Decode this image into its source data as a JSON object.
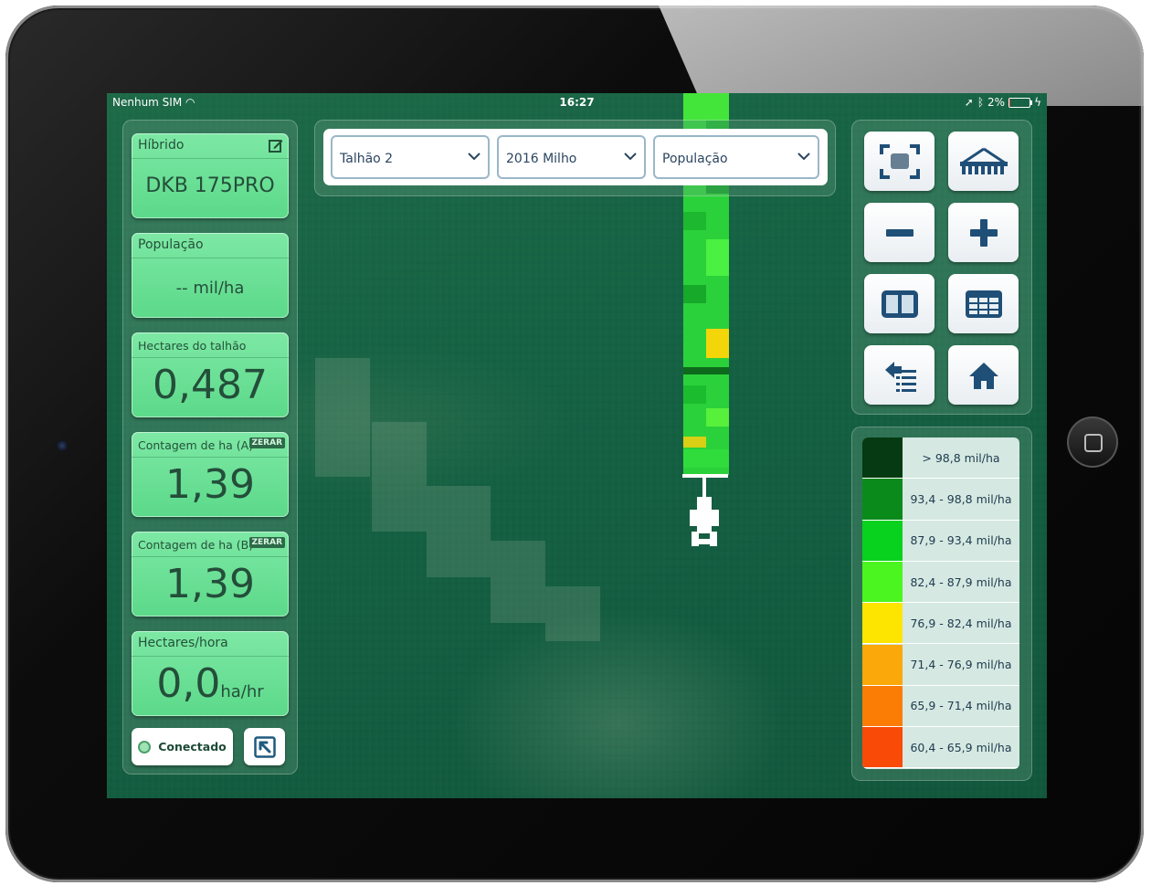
{
  "status_bar": {
    "carrier": "Nenhum SIM",
    "time": "16:27",
    "battery": "2%"
  },
  "cards": {
    "hibrido": {
      "label": "Híbrido",
      "value": "DKB 175PRO"
    },
    "populacao": {
      "label": "População",
      "value": "-- mil/ha"
    },
    "hectares_talhao": {
      "label": "Hectares do talhão",
      "value": "0,487"
    },
    "contagem_a": {
      "label": "Contagem de ha (A)",
      "badge": "ZERAR",
      "value": "1,39"
    },
    "contagem_b": {
      "label": "Contagem de ha (B)",
      "badge": "ZERAR",
      "value": "1,39"
    },
    "hectares_hora": {
      "label": "Hectares/hora",
      "value": "0,0",
      "unit": "ha/hr"
    }
  },
  "connection": {
    "label": "Conectado"
  },
  "dropdowns": {
    "field": "Talhão 2",
    "season": "2016 Milho",
    "layer": "População"
  },
  "toolbar": {
    "icons": [
      "fit-screen-icon",
      "planter-icon",
      "zoom-out-icon",
      "zoom-in-icon",
      "split-view-icon",
      "table-icon",
      "list-back-icon",
      "home-icon"
    ]
  },
  "legend": [
    {
      "label": "> 98,8 mil/ha",
      "color": "#053a12"
    },
    {
      "label": "93,4 - 98,8 mil/ha",
      "color": "#0b8a1c"
    },
    {
      "label": "87,9 - 93,4 mil/ha",
      "color": "#09d21e"
    },
    {
      "label": "82,4 - 87,9 mil/ha",
      "color": "#4bf51f"
    },
    {
      "label": "76,9 - 82,4 mil/ha",
      "color": "#fde500"
    },
    {
      "label": "71,4 - 76,9 mil/ha",
      "color": "#fba90a"
    },
    {
      "label": "65,9 - 71,4 mil/ha",
      "color": "#fb7d06"
    },
    {
      "label": "60,4 - 65,9 mil/ha",
      "color": "#fa4a08"
    }
  ],
  "colors": {
    "card": "#6fe39a",
    "accent": "#2d6a48"
  }
}
